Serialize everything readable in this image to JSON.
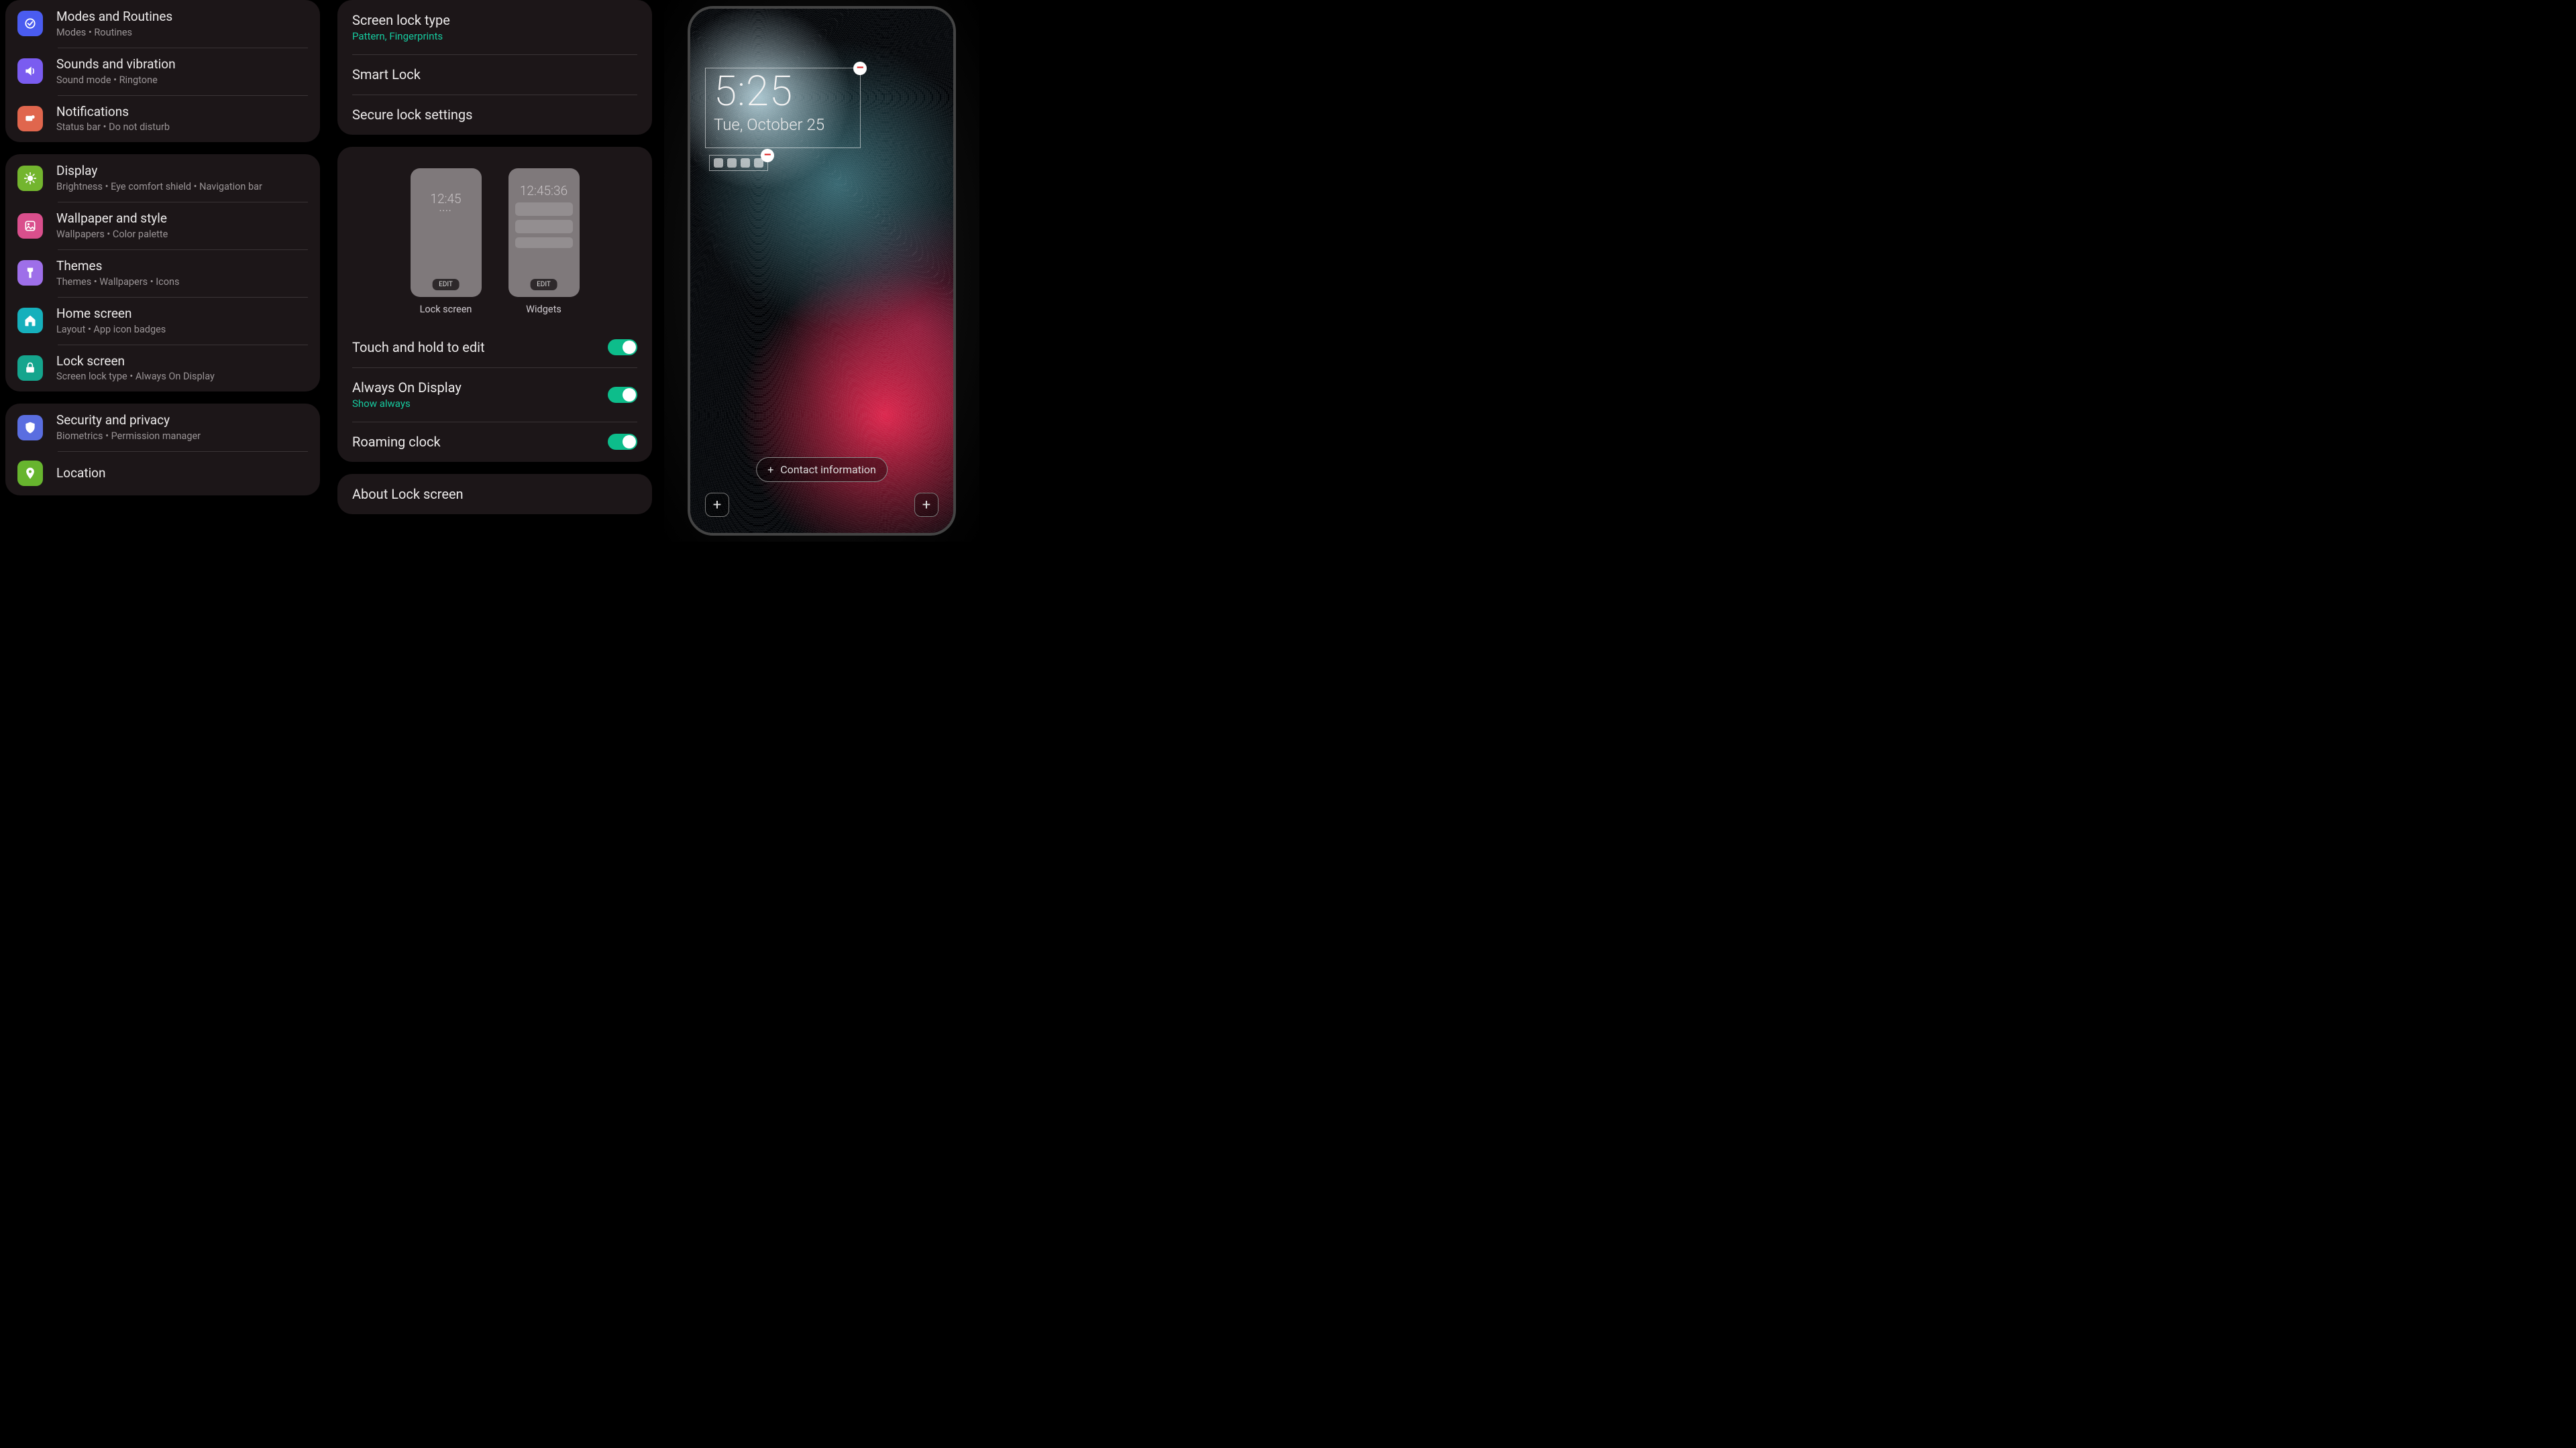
{
  "settings": {
    "group1": [
      {
        "title": "Modes and Routines",
        "sub": "Modes  •  Routines",
        "iconbg": "#4a5cf0",
        "icon": "modes"
      },
      {
        "title": "Sounds and vibration",
        "sub": "Sound mode  •  Ringtone",
        "iconbg": "#7a5cf0",
        "icon": "sound"
      },
      {
        "title": "Notifications",
        "sub": "Status bar  •  Do not disturb",
        "iconbg": "#e0664d",
        "icon": "notif"
      }
    ],
    "group2": [
      {
        "title": "Display",
        "sub": "Brightness  •  Eye comfort shield  •  Navigation bar",
        "iconbg": "#73b52e",
        "icon": "display"
      },
      {
        "title": "Wallpaper and style",
        "sub": "Wallpapers  •  Color palette",
        "iconbg": "#d94f8c",
        "icon": "wallpaper"
      },
      {
        "title": "Themes",
        "sub": "Themes  •  Wallpapers  •  Icons",
        "iconbg": "#9e6fe9",
        "icon": "themes"
      },
      {
        "title": "Home screen",
        "sub": "Layout  •  App icon badges",
        "iconbg": "#16b0bc",
        "icon": "home"
      },
      {
        "title": "Lock screen",
        "sub": "Screen lock type  •  Always On Display",
        "iconbg": "#15a58d",
        "icon": "lock"
      }
    ],
    "group3": [
      {
        "title": "Security and privacy",
        "sub": "Biometrics  •  Permission manager",
        "iconbg": "#5a6ee0",
        "icon": "shield"
      },
      {
        "title": "Location",
        "sub": "",
        "iconbg": "#67b52e",
        "icon": "location"
      }
    ]
  },
  "lock": {
    "screen_lock_type": {
      "title": "Screen lock type",
      "sub": "Pattern, Fingerprints"
    },
    "smart_lock": "Smart Lock",
    "secure_lock": "Secure lock settings",
    "preview": {
      "lock_time": "12:45",
      "widget_time": "12:45:36",
      "edit_label": "EDIT",
      "lock_label": "Lock screen",
      "widget_label": "Widgets"
    },
    "touch_hold": {
      "title": "Touch and hold to edit",
      "on": true
    },
    "aod": {
      "title": "Always On Display",
      "sub": "Show always",
      "on": true
    },
    "roaming": {
      "title": "Roaming clock",
      "on": true
    },
    "about": "About Lock screen"
  },
  "editor": {
    "time": "5:25",
    "date": "Tue, October 25",
    "contact_label": "Contact information",
    "minus": "–",
    "plus": "+"
  }
}
